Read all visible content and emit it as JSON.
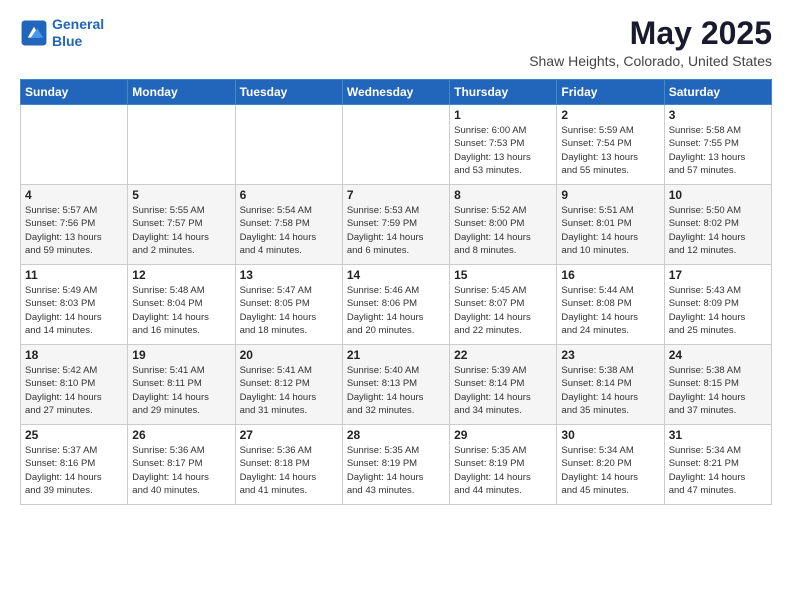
{
  "logo": {
    "line1": "General",
    "line2": "Blue"
  },
  "title": "May 2025",
  "subtitle": "Shaw Heights, Colorado, United States",
  "weekdays": [
    "Sunday",
    "Monday",
    "Tuesday",
    "Wednesday",
    "Thursday",
    "Friday",
    "Saturday"
  ],
  "weeks": [
    [
      {
        "day": "",
        "info": ""
      },
      {
        "day": "",
        "info": ""
      },
      {
        "day": "",
        "info": ""
      },
      {
        "day": "",
        "info": ""
      },
      {
        "day": "1",
        "info": "Sunrise: 6:00 AM\nSunset: 7:53 PM\nDaylight: 13 hours\nand 53 minutes."
      },
      {
        "day": "2",
        "info": "Sunrise: 5:59 AM\nSunset: 7:54 PM\nDaylight: 13 hours\nand 55 minutes."
      },
      {
        "day": "3",
        "info": "Sunrise: 5:58 AM\nSunset: 7:55 PM\nDaylight: 13 hours\nand 57 minutes."
      }
    ],
    [
      {
        "day": "4",
        "info": "Sunrise: 5:57 AM\nSunset: 7:56 PM\nDaylight: 13 hours\nand 59 minutes."
      },
      {
        "day": "5",
        "info": "Sunrise: 5:55 AM\nSunset: 7:57 PM\nDaylight: 14 hours\nand 2 minutes."
      },
      {
        "day": "6",
        "info": "Sunrise: 5:54 AM\nSunset: 7:58 PM\nDaylight: 14 hours\nand 4 minutes."
      },
      {
        "day": "7",
        "info": "Sunrise: 5:53 AM\nSunset: 7:59 PM\nDaylight: 14 hours\nand 6 minutes."
      },
      {
        "day": "8",
        "info": "Sunrise: 5:52 AM\nSunset: 8:00 PM\nDaylight: 14 hours\nand 8 minutes."
      },
      {
        "day": "9",
        "info": "Sunrise: 5:51 AM\nSunset: 8:01 PM\nDaylight: 14 hours\nand 10 minutes."
      },
      {
        "day": "10",
        "info": "Sunrise: 5:50 AM\nSunset: 8:02 PM\nDaylight: 14 hours\nand 12 minutes."
      }
    ],
    [
      {
        "day": "11",
        "info": "Sunrise: 5:49 AM\nSunset: 8:03 PM\nDaylight: 14 hours\nand 14 minutes."
      },
      {
        "day": "12",
        "info": "Sunrise: 5:48 AM\nSunset: 8:04 PM\nDaylight: 14 hours\nand 16 minutes."
      },
      {
        "day": "13",
        "info": "Sunrise: 5:47 AM\nSunset: 8:05 PM\nDaylight: 14 hours\nand 18 minutes."
      },
      {
        "day": "14",
        "info": "Sunrise: 5:46 AM\nSunset: 8:06 PM\nDaylight: 14 hours\nand 20 minutes."
      },
      {
        "day": "15",
        "info": "Sunrise: 5:45 AM\nSunset: 8:07 PM\nDaylight: 14 hours\nand 22 minutes."
      },
      {
        "day": "16",
        "info": "Sunrise: 5:44 AM\nSunset: 8:08 PM\nDaylight: 14 hours\nand 24 minutes."
      },
      {
        "day": "17",
        "info": "Sunrise: 5:43 AM\nSunset: 8:09 PM\nDaylight: 14 hours\nand 25 minutes."
      }
    ],
    [
      {
        "day": "18",
        "info": "Sunrise: 5:42 AM\nSunset: 8:10 PM\nDaylight: 14 hours\nand 27 minutes."
      },
      {
        "day": "19",
        "info": "Sunrise: 5:41 AM\nSunset: 8:11 PM\nDaylight: 14 hours\nand 29 minutes."
      },
      {
        "day": "20",
        "info": "Sunrise: 5:41 AM\nSunset: 8:12 PM\nDaylight: 14 hours\nand 31 minutes."
      },
      {
        "day": "21",
        "info": "Sunrise: 5:40 AM\nSunset: 8:13 PM\nDaylight: 14 hours\nand 32 minutes."
      },
      {
        "day": "22",
        "info": "Sunrise: 5:39 AM\nSunset: 8:14 PM\nDaylight: 14 hours\nand 34 minutes."
      },
      {
        "day": "23",
        "info": "Sunrise: 5:38 AM\nSunset: 8:14 PM\nDaylight: 14 hours\nand 35 minutes."
      },
      {
        "day": "24",
        "info": "Sunrise: 5:38 AM\nSunset: 8:15 PM\nDaylight: 14 hours\nand 37 minutes."
      }
    ],
    [
      {
        "day": "25",
        "info": "Sunrise: 5:37 AM\nSunset: 8:16 PM\nDaylight: 14 hours\nand 39 minutes."
      },
      {
        "day": "26",
        "info": "Sunrise: 5:36 AM\nSunset: 8:17 PM\nDaylight: 14 hours\nand 40 minutes."
      },
      {
        "day": "27",
        "info": "Sunrise: 5:36 AM\nSunset: 8:18 PM\nDaylight: 14 hours\nand 41 minutes."
      },
      {
        "day": "28",
        "info": "Sunrise: 5:35 AM\nSunset: 8:19 PM\nDaylight: 14 hours\nand 43 minutes."
      },
      {
        "day": "29",
        "info": "Sunrise: 5:35 AM\nSunset: 8:19 PM\nDaylight: 14 hours\nand 44 minutes."
      },
      {
        "day": "30",
        "info": "Sunrise: 5:34 AM\nSunset: 8:20 PM\nDaylight: 14 hours\nand 45 minutes."
      },
      {
        "day": "31",
        "info": "Sunrise: 5:34 AM\nSunset: 8:21 PM\nDaylight: 14 hours\nand 47 minutes."
      }
    ]
  ]
}
